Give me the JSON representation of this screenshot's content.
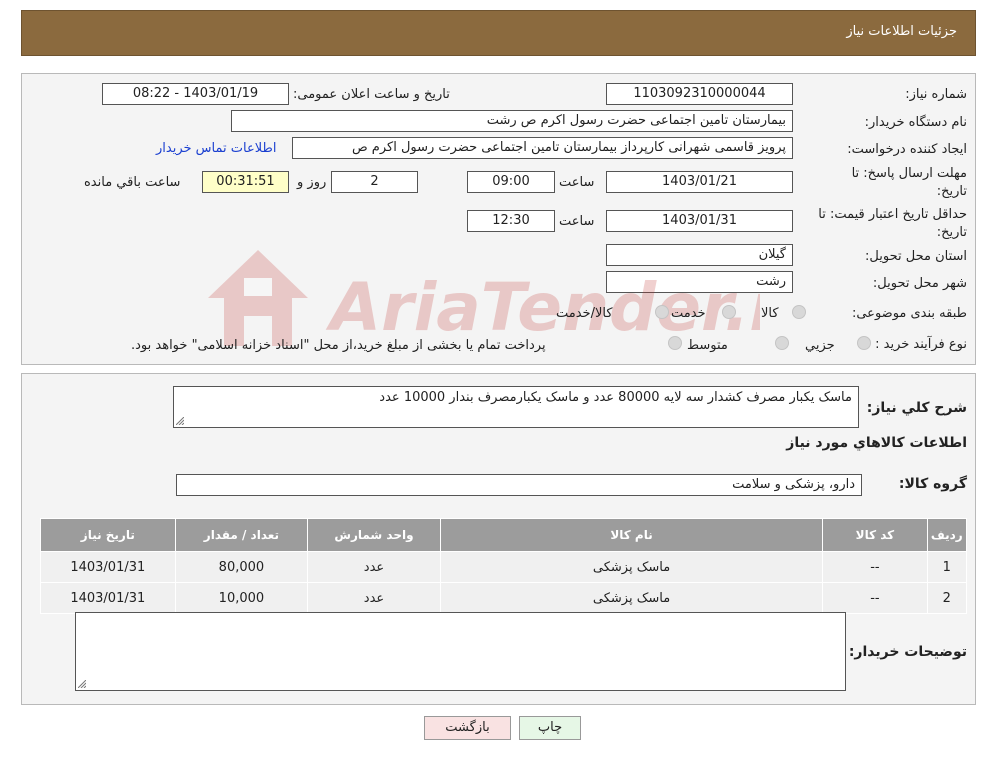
{
  "header": {
    "title": "جزئیات اطلاعات نیاز"
  },
  "form": {
    "need_number_label": "شماره نیاز:",
    "need_number": "1103092310000044",
    "announce_label": "تاریخ و ساعت اعلان عمومی:",
    "announce_value": "1403/01/19 - 08:22",
    "buyer_org_label": "نام دستگاه خریدار:",
    "buyer_org": "بیمارستان  تامین اجتماعی حضرت رسول اکرم ص رشت",
    "requester_label": "ایجاد کننده درخواست:",
    "requester": "پرویز قاسمی شهرانی کارپرداز بیمارستان  تامین اجتماعی حضرت رسول اکرم ص",
    "contact_link": "اطلاعات تماس خریدار",
    "deadline_label_1": "مهلت ارسال پاسخ: تا",
    "deadline_label_2": "تاریخ:",
    "deadline_date": "1403/01/21",
    "time_label": "ساعت",
    "deadline_time": "09:00",
    "days": "2",
    "days_and": "روز و",
    "remaining": "00:31:51",
    "remaining_label": "ساعت باقي مانده",
    "validity_label_1": "حداقل تاریخ اعتبار قیمت: تا",
    "validity_label_2": "تاریخ:",
    "validity_date": "1403/01/31",
    "validity_time": "12:30",
    "province_label": "استان محل تحویل:",
    "province": "گیلان",
    "city_label": "شهر محل تحویل:",
    "city": "رشت",
    "category_label": "طبقه بندی موضوعی:",
    "category_options": [
      "کالا",
      "خدمت",
      "کالا/خدمت"
    ],
    "process_label": "نوع فرآیند خرید :",
    "process_options": [
      "جزیي",
      "متوسط"
    ],
    "process_note": "پرداخت تمام یا بخشی از مبلغ خرید،از محل \"اسناد خزانه اسلامی\" خواهد بود."
  },
  "details": {
    "description_label": "شرح کلي نیاز:",
    "description": "ماسک یکبار مصرف کشدار سه لایه 80000 عدد و ماسک یکبارمصرف بندار 10000 عدد",
    "goods_info_title": "اطلاعات کالاهاي مورد نیاز",
    "goods_group_label": "گروه کالا:",
    "goods_group": "دارو، پزشکی و سلامت",
    "table": {
      "headers": [
        "ردیف",
        "کد کالا",
        "نام کالا",
        "واحد شمارش",
        "تعداد / مقدار",
        "تاریخ نیاز"
      ],
      "rows": [
        [
          "1",
          "--",
          "ماسک پزشکی",
          "عدد",
          "80,000",
          "1403/01/31"
        ],
        [
          "2",
          "--",
          "ماسک پزشکی",
          "عدد",
          "10,000",
          "1403/01/31"
        ]
      ]
    },
    "buyer_notes_label": "توضیحات خریدار:",
    "buyer_notes": ""
  },
  "buttons": {
    "print": "چاپ",
    "back": "بازگشت"
  },
  "watermark": {
    "text": "AriaTender.neT"
  },
  "colors": {
    "header_bg": "#8b6a3e",
    "link": "#1a3fd0",
    "remaining_bg": "#ffffc8",
    "print_bg": "#e6f7e6",
    "back_bg": "#f9e2e2",
    "watermark": "#c0302a"
  }
}
